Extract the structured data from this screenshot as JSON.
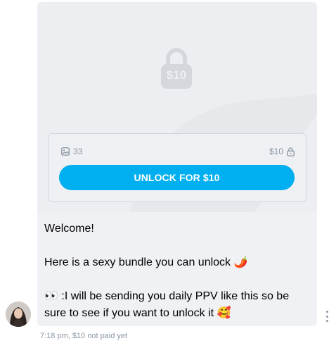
{
  "post": {
    "big_lock_price": "$10",
    "media_count": "33",
    "price": "$10",
    "unlock_button_label": "UNLOCK FOR $10"
  },
  "message": {
    "line1": "Welcome!",
    "line2": "Here is a sexy bundle you can unlock 🌶️",
    "line3": "👀 :I will be sending you daily PPV like this so be sure to see if you want to unlock it 🥰"
  },
  "meta": {
    "time": "7:18 pm,",
    "status": "$10 not paid yet"
  },
  "colors": {
    "accent": "#00aff0",
    "muted": "#8a96a3",
    "card_bg": "#f0f1f4"
  },
  "icons": [
    "lock-icon",
    "image-icon",
    "padlock-icon",
    "more-options-icon",
    "avatar"
  ]
}
